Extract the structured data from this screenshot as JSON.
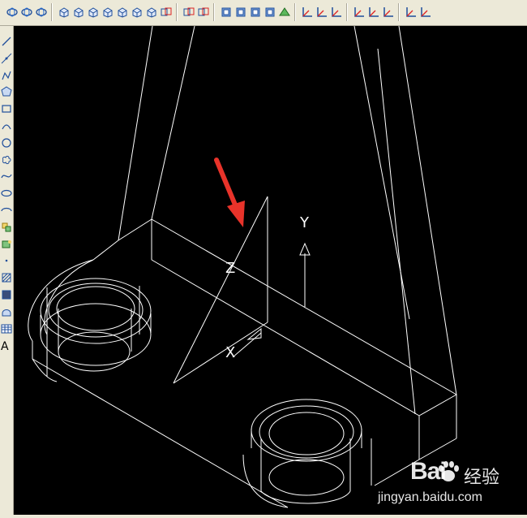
{
  "toolbar": {
    "groups": [
      [
        "orbit-icon",
        "orbit-icon",
        "orbit-icon"
      ],
      [
        "box-icon",
        "cylinder-icon",
        "cube-icon",
        "wedge-icon",
        "revolve-icon",
        "sweep-icon",
        "union-icon",
        "slice-icon"
      ],
      [
        "section-icon",
        "interference-icon"
      ],
      [
        "shade-icon",
        "render-icon",
        "render-icon",
        "material-icon",
        "light-icon"
      ],
      [
        "ucs-icon",
        "ucs-icon",
        "ucs-icon"
      ],
      [
        "ucs-icon",
        "ucs-icon",
        "ucs-icon"
      ],
      [
        "ucs-icon",
        "ucs-icon"
      ]
    ]
  },
  "draw_toolbar": {
    "tools": [
      "line-icon",
      "construction-line-icon",
      "polyline-icon",
      "polygon-icon",
      "rectangle-icon",
      "arc-icon",
      "circle-icon",
      "revision-cloud-icon",
      "spline-icon",
      "ellipse-icon",
      "ellipse-arc-icon",
      "insert-block-icon",
      "make-block-icon",
      "point-icon",
      "hatch-icon",
      "gradient-icon",
      "region-icon",
      "table-icon",
      "multiline-text-icon"
    ],
    "text_tool_label": "A"
  },
  "ucs_icon": {
    "y_label": "Y",
    "z_label": "Z",
    "x_label": "X"
  },
  "watermark": {
    "brand": "Bai",
    "brand_cn": "经验",
    "url": "jingyan.baidu.com"
  }
}
